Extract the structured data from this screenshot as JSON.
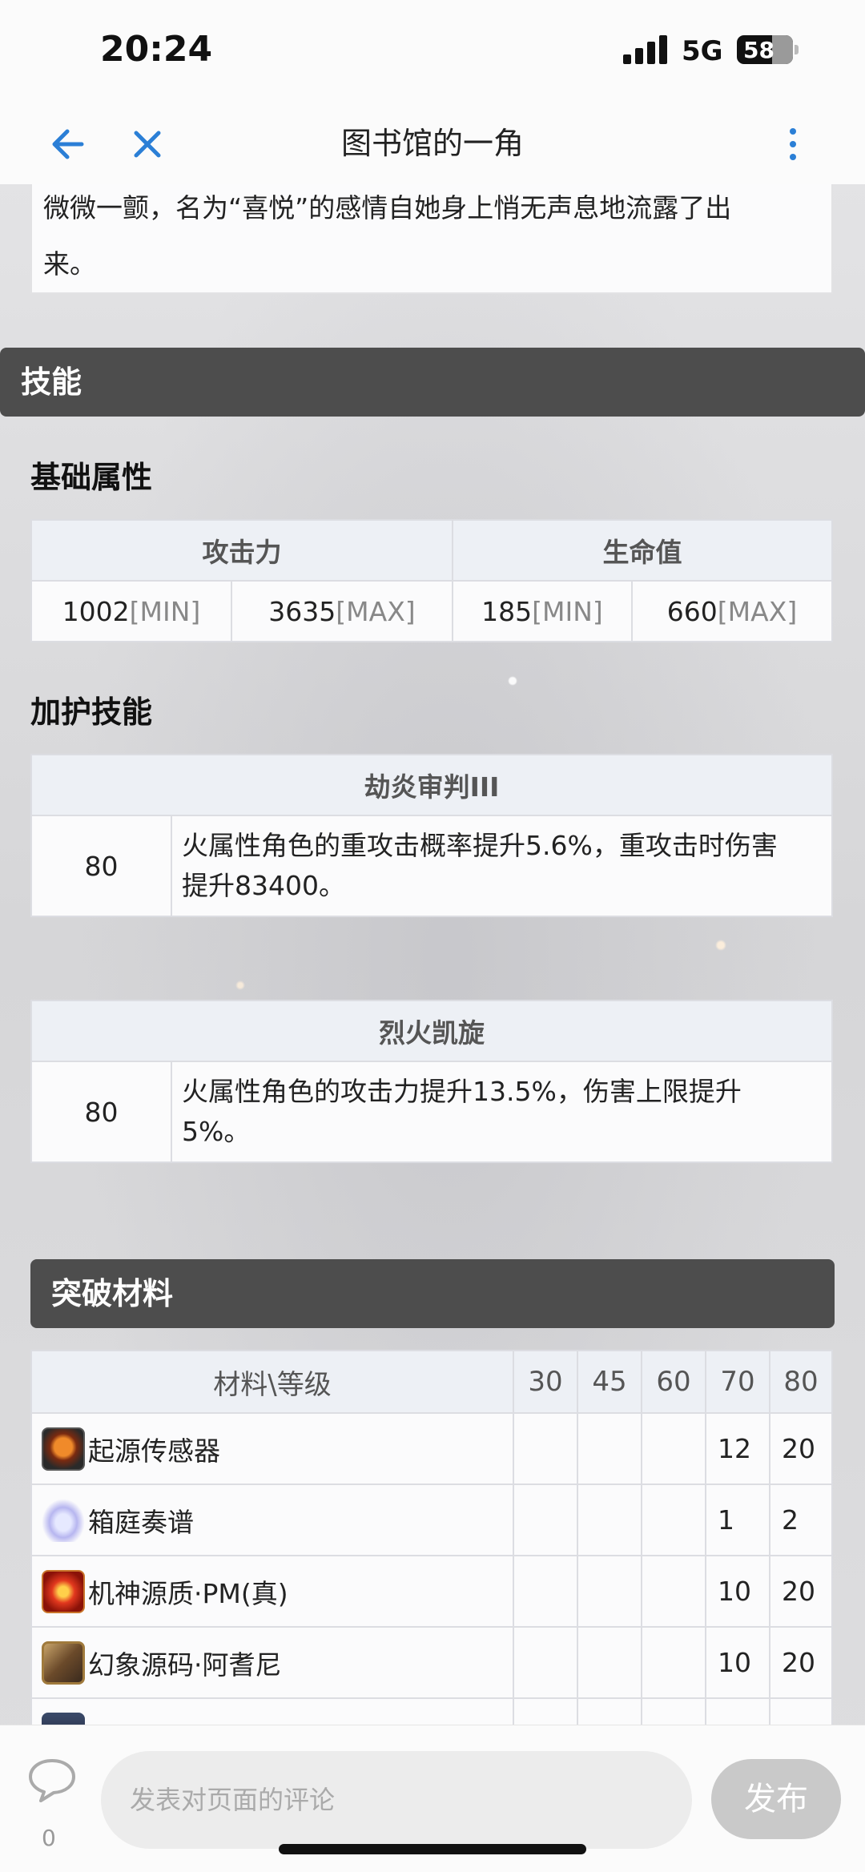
{
  "status_bar": {
    "time": "20:24",
    "network": "5G",
    "battery": "58"
  },
  "nav": {
    "title": "图书馆的一角"
  },
  "lore": {
    "line1": "微微一颤，名为“喜悦”的感情自她身上悄无声息地流露了出",
    "line2": "来。"
  },
  "skills_section": {
    "title": "技能"
  },
  "base_stats": {
    "heading": "基础属性",
    "columns": [
      "攻击力",
      "生命值"
    ],
    "atk_min": "1002",
    "atk_max": "3635",
    "hp_min": "185",
    "hp_max": "660",
    "min_label": "[MIN]",
    "max_label": "[MAX]"
  },
  "guard_skills": {
    "heading": "加护技能",
    "items": [
      {
        "name": "劫炎审判III",
        "level": "80",
        "desc1": "火属性角色的重攻击概率提升5.6%，重攻击时伤害",
        "desc2": "提升83400。"
      },
      {
        "name": "烈火凯旋",
        "level": "80",
        "desc1": "火属性角色的攻击力提升13.5%，伤害上限提升",
        "desc2": "5%。"
      }
    ]
  },
  "materials": {
    "title": "突破材料",
    "header": [
      "材料\\等级",
      "30",
      "45",
      "60",
      "70",
      "80"
    ],
    "rows": [
      {
        "name": "起源传感器",
        "icon": "origin-sensor-icon",
        "v30": "",
        "v45": "",
        "v60": "",
        "v70": "12",
        "v80": "20"
      },
      {
        "name": "箱庭奏谱",
        "icon": "music-score-icon",
        "v30": "",
        "v45": "",
        "v60": "",
        "v70": "1",
        "v80": "2"
      },
      {
        "name": "机神源质·PM(真)",
        "icon": "machine-essence-icon",
        "v30": "",
        "v45": "",
        "v60": "",
        "v70": "10",
        "v80": "20"
      },
      {
        "name": "幻象源码·阿耆尼",
        "icon": "illusion-code-icon",
        "v30": "",
        "v45": "",
        "v60": "",
        "v70": "10",
        "v80": "20"
      }
    ]
  },
  "comment_bar": {
    "count": "0",
    "placeholder": "发表对页面的评论",
    "publish_label": "发布"
  }
}
